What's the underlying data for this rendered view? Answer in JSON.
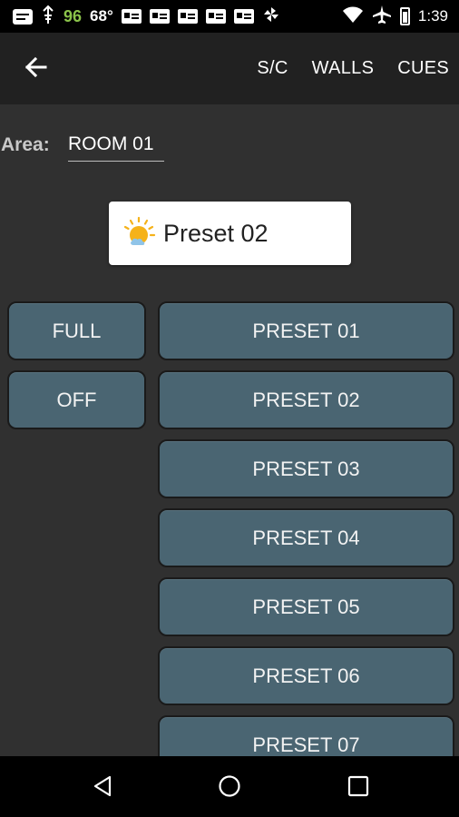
{
  "status_bar": {
    "signal_value": "96",
    "temperature": "68°",
    "time": "1:39"
  },
  "app_bar": {
    "menu": [
      {
        "label": "S/C"
      },
      {
        "label": "WALLS"
      },
      {
        "label": "CUES"
      }
    ]
  },
  "area": {
    "label": "Area:",
    "value": "ROOM 01"
  },
  "current_preset": {
    "label": "Preset 02",
    "icon": "sun-cloud-icon"
  },
  "left_buttons": [
    {
      "label": "FULL"
    },
    {
      "label": "OFF"
    }
  ],
  "presets": [
    {
      "label": "PRESET 01"
    },
    {
      "label": "PRESET 02"
    },
    {
      "label": "PRESET 03"
    },
    {
      "label": "PRESET 04"
    },
    {
      "label": "PRESET 05"
    },
    {
      "label": "PRESET 06"
    },
    {
      "label": "PRESET 07"
    }
  ],
  "colors": {
    "background": "#303030",
    "app_bar": "#212121",
    "button": "#4a6572",
    "signal_value": "#8bc34a"
  }
}
